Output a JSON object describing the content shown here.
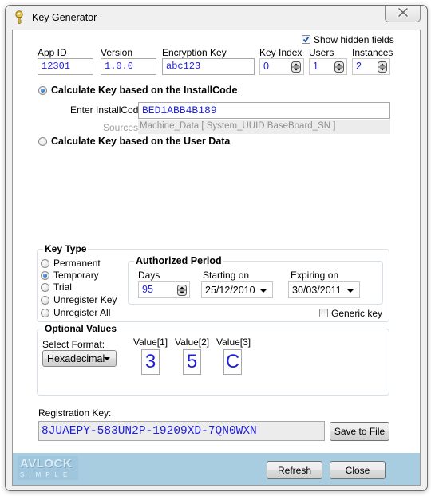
{
  "window": {
    "title": "Key Generator",
    "icon": "key-icon",
    "close_icon": "close-icon"
  },
  "top": {
    "show_hidden_fields": {
      "label": "Show hidden fields",
      "checked": true
    },
    "app_id": {
      "label": "App ID",
      "value": "12301"
    },
    "version": {
      "label": "Version",
      "value": "1.0.0"
    },
    "encryption_key": {
      "label": "Encryption Key",
      "value": "abc123"
    },
    "key_index": {
      "label": "Key Index",
      "value": "0"
    },
    "users": {
      "label": "Users",
      "value": "1"
    },
    "instances": {
      "label": "Instances",
      "value": "2"
    }
  },
  "mode": {
    "install_code_option": {
      "label": "Calculate Key based on the InstallCode",
      "selected": true
    },
    "install_code": {
      "label": "Enter InstallCode:",
      "value": "BED1ABB4B189"
    },
    "sources": {
      "label": "Sources:",
      "value": "Machine_Data [ System_UUID BaseBoard_SN ]"
    },
    "user_data_option": {
      "label": "Calculate Key based on the User Data",
      "selected": false
    }
  },
  "key_type": {
    "title": "Key Type",
    "options": [
      {
        "label": "Permanent",
        "selected": false
      },
      {
        "label": "Temporary",
        "selected": true
      },
      {
        "label": "Trial",
        "selected": false
      },
      {
        "label": "Unregister Key",
        "selected": false
      },
      {
        "label": "Unregister All",
        "selected": false
      }
    ],
    "authorized_period": {
      "title": "Authorized Period",
      "days": {
        "label": "Days",
        "value": "95"
      },
      "starting_on": {
        "label": "Starting on",
        "value": "25/12/2010"
      },
      "expiring_on": {
        "label": "Expiring on",
        "value": "30/03/2011"
      }
    },
    "generic_key": {
      "label": "Generic key",
      "checked": false
    }
  },
  "optional_values": {
    "title": "Optional Values",
    "format_label": "Select Format:",
    "format_value": "Hexadecimal",
    "values": [
      {
        "label": "Value[1]",
        "value": "3"
      },
      {
        "label": "Value[2]",
        "value": "5"
      },
      {
        "label": "Value[3]",
        "value": "C"
      }
    ]
  },
  "registration": {
    "label": "Registration Key:",
    "value": "8JUAEPY-583UN2P-19209XD-7QN0WXN",
    "save_button": "Save to File"
  },
  "footer": {
    "logo_main": "AVLOCK",
    "logo_sub": "SIMPLE",
    "refresh_button": "Refresh",
    "close_button": "Close"
  },
  "colors": {
    "value_text": "#1f1fd8",
    "footer_bg": "#a9cde0",
    "group_border": "#d5dfe5"
  }
}
